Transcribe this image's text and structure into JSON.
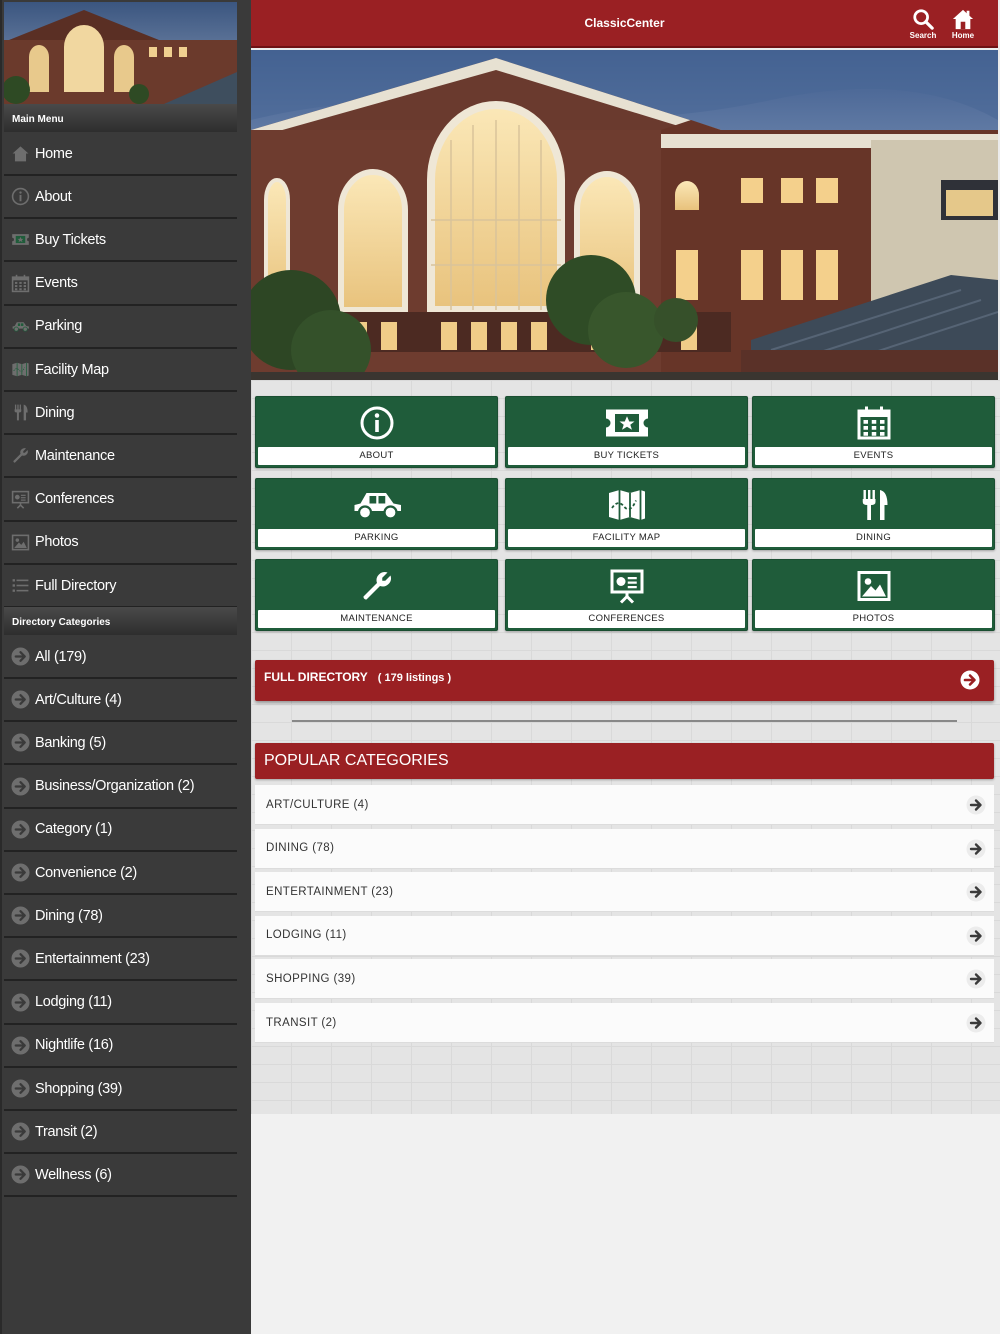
{
  "header": {
    "title": "ClassicCenter",
    "search_label": "Search",
    "home_label": "Home"
  },
  "sidebar": {
    "main_menu_title": "Main Menu",
    "main_items": [
      {
        "label": "Home",
        "icon": "home-icon"
      },
      {
        "label": "About",
        "icon": "info-icon"
      },
      {
        "label": "Buy Tickets",
        "icon": "ticket-icon"
      },
      {
        "label": "Events",
        "icon": "calendar-icon"
      },
      {
        "label": "Parking",
        "icon": "car-icon"
      },
      {
        "label": "Facility Map",
        "icon": "map-icon"
      },
      {
        "label": "Dining",
        "icon": "fork-knife-icon"
      },
      {
        "label": "Maintenance",
        "icon": "wrench-icon"
      },
      {
        "label": "Conferences",
        "icon": "presentation-icon"
      },
      {
        "label": "Photos",
        "icon": "photo-icon"
      },
      {
        "label": "Full Directory",
        "icon": "list-icon"
      }
    ],
    "categories_title": "Directory Categories",
    "category_items": [
      {
        "label": "All (179)"
      },
      {
        "label": "Art/Culture (4)"
      },
      {
        "label": "Banking (5)"
      },
      {
        "label": "Business/Organization (2)"
      },
      {
        "label": "Category (1)"
      },
      {
        "label": "Convenience (2)"
      },
      {
        "label": "Dining (78)"
      },
      {
        "label": "Entertainment (23)"
      },
      {
        "label": "Lodging (11)"
      },
      {
        "label": "Nightlife (16)"
      },
      {
        "label": "Shopping (39)"
      },
      {
        "label": "Transit (2)"
      },
      {
        "label": "Wellness (6)"
      }
    ]
  },
  "tiles": [
    {
      "label": "ABOUT",
      "icon": "info-icon"
    },
    {
      "label": "BUY TICKETS",
      "icon": "ticket-icon"
    },
    {
      "label": "EVENTS",
      "icon": "calendar-icon"
    },
    {
      "label": "PARKING",
      "icon": "car-icon"
    },
    {
      "label": "FACILITY MAP",
      "icon": "map-icon"
    },
    {
      "label": "DINING",
      "icon": "fork-knife-icon"
    },
    {
      "label": "MAINTENANCE",
      "icon": "wrench-icon"
    },
    {
      "label": "CONFERENCES",
      "icon": "presentation-icon"
    },
    {
      "label": "PHOTOS",
      "icon": "photo-icon"
    }
  ],
  "full_directory": {
    "label": "FULL DIRECTORY",
    "count": "( 179 listings )"
  },
  "popular": {
    "title": "POPULAR CATEGORIES",
    "items": [
      {
        "label": "ART/CULTURE (4)"
      },
      {
        "label": "DINING (78)"
      },
      {
        "label": "ENTERTAINMENT (23)"
      },
      {
        "label": "LODGING (11)"
      },
      {
        "label": "SHOPPING (39)"
      },
      {
        "label": "TRANSIT (2)"
      }
    ]
  },
  "colors": {
    "brand_red": "#9a2023",
    "tile_green": "#1f5c3a",
    "sidebar_bg": "#3a3a3a"
  }
}
